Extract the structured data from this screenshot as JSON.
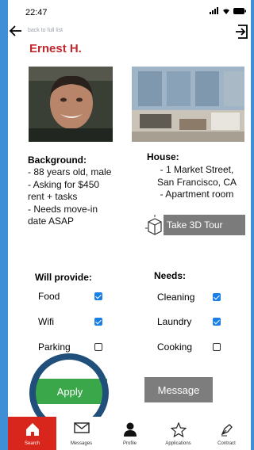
{
  "status": {
    "time": "22:47"
  },
  "nav": {
    "back_label": "back to full list"
  },
  "profile": {
    "name": "Ernest H."
  },
  "background": {
    "title": "Background:",
    "lines": [
      " - 88 years old, male",
      " - Asking for $450",
      "rent + tasks",
      " - Needs move-in",
      "date ASAP"
    ]
  },
  "house": {
    "title": "House:",
    "lines": [
      " - 1 Market Street,",
      "San Francisco, CA",
      " - Apartment room"
    ],
    "tour_label": "Take 3D Tour"
  },
  "provide": {
    "title": "Will provide:",
    "items": [
      {
        "label": "Food",
        "checked": true
      },
      {
        "label": "Wifi",
        "checked": true
      },
      {
        "label": "Parking",
        "checked": false
      }
    ]
  },
  "needs": {
    "title": "Needs:",
    "items": [
      {
        "label": "Cleaning",
        "checked": true
      },
      {
        "label": "Laundry",
        "checked": true
      },
      {
        "label": "Cooking",
        "checked": false
      }
    ]
  },
  "actions": {
    "apply_label": "Apply",
    "message_label": "Message"
  },
  "tabs": [
    {
      "label": "Search",
      "icon": "home-icon",
      "active": true
    },
    {
      "label": "Messages",
      "icon": "envelope-icon",
      "active": false
    },
    {
      "label": "Profile",
      "icon": "person-icon",
      "active": false
    },
    {
      "label": "Applications",
      "icon": "star-icon",
      "active": false
    },
    {
      "label": "Contract",
      "icon": "pen-icon",
      "active": false
    }
  ],
  "colors": {
    "background": "#3f8fd6",
    "name": "#c1272d",
    "apply": "#3aa84a",
    "active_tab": "#d9261c",
    "checkbox": "#1a7ee8"
  }
}
